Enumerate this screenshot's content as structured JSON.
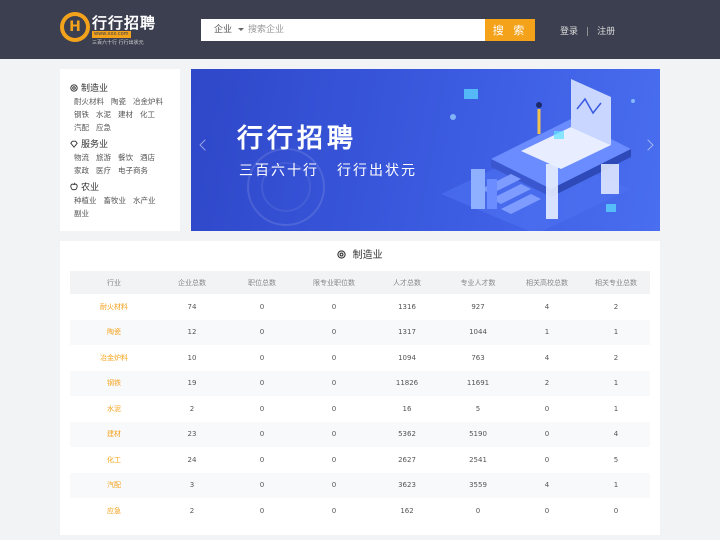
{
  "header": {
    "logo_mark": "H",
    "logo_name": "行行招聘",
    "logo_url": "www.xxx.com",
    "logo_slogan": "三百六十行 行行出状元",
    "search_type": "企业",
    "search_placeholder": "搜索企业",
    "search_button": "搜 索",
    "login": "登录",
    "separator": "|",
    "register": "注册",
    "accent_color": "#f5a21b",
    "bg_color": "#3b3f4f"
  },
  "sidebar": {
    "categories": [
      {
        "icon": "gear-icon",
        "title": "制造业",
        "items": [
          "耐火材料",
          "陶瓷",
          "冶金炉料",
          "钢铁",
          "水泥",
          "建材",
          "化工",
          "汽配",
          "应急"
        ]
      },
      {
        "icon": "diamond-icon",
        "title": "服务业",
        "items": [
          "物流",
          "旅游",
          "餐饮",
          "酒店",
          "家政",
          "医疗",
          "电子商务"
        ]
      },
      {
        "icon": "apple-icon",
        "title": "农业",
        "items": [
          "种植业",
          "畜牧业",
          "水产业",
          "副业"
        ]
      }
    ]
  },
  "banner": {
    "title": "行行招聘",
    "subtitle_1": "三百六十行",
    "subtitle_2": "行行出状元",
    "bg_color": "#3b5be0"
  },
  "table": {
    "title": "制造业",
    "headers": [
      "行业",
      "企业总数",
      "职位总数",
      "限专业职位数",
      "人才总数",
      "专业人才数",
      "相关高校总数",
      "相关专业总数"
    ],
    "rows": [
      [
        "耐火材料",
        "74",
        "0",
        "0",
        "1316",
        "927",
        "4",
        "2"
      ],
      [
        "陶瓷",
        "12",
        "0",
        "0",
        "1317",
        "1044",
        "1",
        "1"
      ],
      [
        "冶金炉料",
        "10",
        "0",
        "0",
        "1094",
        "763",
        "4",
        "2"
      ],
      [
        "钢铁",
        "19",
        "0",
        "0",
        "11826",
        "11691",
        "2",
        "1"
      ],
      [
        "水泥",
        "2",
        "0",
        "0",
        "16",
        "5",
        "0",
        "1"
      ],
      [
        "建材",
        "23",
        "0",
        "0",
        "5362",
        "5190",
        "0",
        "4"
      ],
      [
        "化工",
        "24",
        "0",
        "0",
        "2627",
        "2541",
        "0",
        "5"
      ],
      [
        "汽配",
        "3",
        "0",
        "0",
        "3623",
        "3559",
        "4",
        "1"
      ],
      [
        "应急",
        "2",
        "0",
        "0",
        "162",
        "0",
        "0",
        "0"
      ]
    ]
  }
}
